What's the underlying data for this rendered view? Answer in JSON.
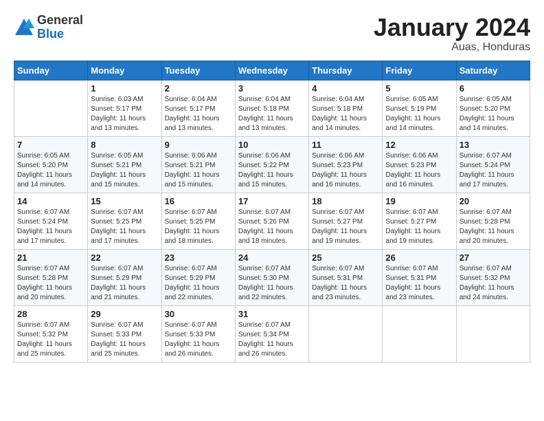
{
  "logo": {
    "general": "General",
    "blue": "Blue"
  },
  "title": "January 2024",
  "location": "Auas, Honduras",
  "days_of_week": [
    "Sunday",
    "Monday",
    "Tuesday",
    "Wednesday",
    "Thursday",
    "Friday",
    "Saturday"
  ],
  "weeks": [
    [
      {
        "day": "",
        "info": ""
      },
      {
        "day": "1",
        "info": "Sunrise: 6:03 AM\nSunset: 5:17 PM\nDaylight: 11 hours\nand 13 minutes."
      },
      {
        "day": "2",
        "info": "Sunrise: 6:04 AM\nSunset: 5:17 PM\nDaylight: 11 hours\nand 13 minutes."
      },
      {
        "day": "3",
        "info": "Sunrise: 6:04 AM\nSunset: 5:18 PM\nDaylight: 11 hours\nand 13 minutes."
      },
      {
        "day": "4",
        "info": "Sunrise: 6:04 AM\nSunset: 5:18 PM\nDaylight: 11 hours\nand 14 minutes."
      },
      {
        "day": "5",
        "info": "Sunrise: 6:05 AM\nSunset: 5:19 PM\nDaylight: 11 hours\nand 14 minutes."
      },
      {
        "day": "6",
        "info": "Sunrise: 6:05 AM\nSunset: 5:20 PM\nDaylight: 11 hours\nand 14 minutes."
      }
    ],
    [
      {
        "day": "7",
        "info": "Sunrise: 6:05 AM\nSunset: 5:20 PM\nDaylight: 11 hours\nand 14 minutes."
      },
      {
        "day": "8",
        "info": "Sunrise: 6:05 AM\nSunset: 5:21 PM\nDaylight: 11 hours\nand 15 minutes."
      },
      {
        "day": "9",
        "info": "Sunrise: 6:06 AM\nSunset: 5:21 PM\nDaylight: 11 hours\nand 15 minutes."
      },
      {
        "day": "10",
        "info": "Sunrise: 6:06 AM\nSunset: 5:22 PM\nDaylight: 11 hours\nand 15 minutes."
      },
      {
        "day": "11",
        "info": "Sunrise: 6:06 AM\nSunset: 5:23 PM\nDaylight: 11 hours\nand 16 minutes."
      },
      {
        "day": "12",
        "info": "Sunrise: 6:06 AM\nSunset: 5:23 PM\nDaylight: 11 hours\nand 16 minutes."
      },
      {
        "day": "13",
        "info": "Sunrise: 6:07 AM\nSunset: 5:24 PM\nDaylight: 11 hours\nand 17 minutes."
      }
    ],
    [
      {
        "day": "14",
        "info": "Sunrise: 6:07 AM\nSunset: 5:24 PM\nDaylight: 11 hours\nand 17 minutes."
      },
      {
        "day": "15",
        "info": "Sunrise: 6:07 AM\nSunset: 5:25 PM\nDaylight: 11 hours\nand 17 minutes."
      },
      {
        "day": "16",
        "info": "Sunrise: 6:07 AM\nSunset: 5:25 PM\nDaylight: 11 hours\nand 18 minutes."
      },
      {
        "day": "17",
        "info": "Sunrise: 6:07 AM\nSunset: 5:26 PM\nDaylight: 11 hours\nand 18 minutes."
      },
      {
        "day": "18",
        "info": "Sunrise: 6:07 AM\nSunset: 5:27 PM\nDaylight: 11 hours\nand 19 minutes."
      },
      {
        "day": "19",
        "info": "Sunrise: 6:07 AM\nSunset: 5:27 PM\nDaylight: 11 hours\nand 19 minutes."
      },
      {
        "day": "20",
        "info": "Sunrise: 6:07 AM\nSunset: 5:28 PM\nDaylight: 11 hours\nand 20 minutes."
      }
    ],
    [
      {
        "day": "21",
        "info": "Sunrise: 6:07 AM\nSunset: 5:28 PM\nDaylight: 11 hours\nand 20 minutes."
      },
      {
        "day": "22",
        "info": "Sunrise: 6:07 AM\nSunset: 5:29 PM\nDaylight: 11 hours\nand 21 minutes."
      },
      {
        "day": "23",
        "info": "Sunrise: 6:07 AM\nSunset: 5:29 PM\nDaylight: 11 hours\nand 22 minutes."
      },
      {
        "day": "24",
        "info": "Sunrise: 6:07 AM\nSunset: 5:30 PM\nDaylight: 11 hours\nand 22 minutes."
      },
      {
        "day": "25",
        "info": "Sunrise: 6:07 AM\nSunset: 5:31 PM\nDaylight: 11 hours\nand 23 minutes."
      },
      {
        "day": "26",
        "info": "Sunrise: 6:07 AM\nSunset: 5:31 PM\nDaylight: 11 hours\nand 23 minutes."
      },
      {
        "day": "27",
        "info": "Sunrise: 6:07 AM\nSunset: 5:32 PM\nDaylight: 11 hours\nand 24 minutes."
      }
    ],
    [
      {
        "day": "28",
        "info": "Sunrise: 6:07 AM\nSunset: 5:32 PM\nDaylight: 11 hours\nand 25 minutes."
      },
      {
        "day": "29",
        "info": "Sunrise: 6:07 AM\nSunset: 5:33 PM\nDaylight: 11 hours\nand 25 minutes."
      },
      {
        "day": "30",
        "info": "Sunrise: 6:07 AM\nSunset: 5:33 PM\nDaylight: 11 hours\nand 26 minutes."
      },
      {
        "day": "31",
        "info": "Sunrise: 6:07 AM\nSunset: 5:34 PM\nDaylight: 11 hours\nand 26 minutes."
      },
      {
        "day": "",
        "info": ""
      },
      {
        "day": "",
        "info": ""
      },
      {
        "day": "",
        "info": ""
      }
    ]
  ]
}
